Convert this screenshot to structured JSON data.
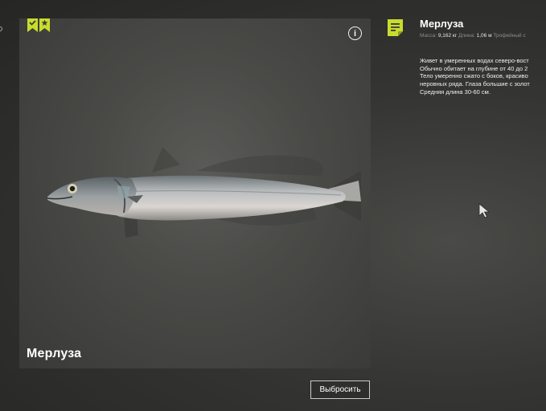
{
  "colors": {
    "accent": "#c8dc2e",
    "text_primary": "#ffffff",
    "text_muted": "#8d8d8a"
  },
  "fish_card": {
    "title": "Мерлуза",
    "bookmark_icons": [
      "bookmark-check-icon",
      "bookmark-star-icon"
    ],
    "info_icon": "i"
  },
  "actions": {
    "discard_label": "Выбросить"
  },
  "details": {
    "title": "Мерлуза",
    "stats": {
      "mass_label": "Масса:",
      "mass_value": "9,162 кг",
      "length_label": "Длина:",
      "length_value": "1,06 м",
      "trophy_label": "Трофейный с"
    },
    "description_lines": [
      "Живет в умеренных водах северо-вост",
      "Обычно обитает на глубине от 40 до 2",
      "Тело умеренно сжато с боков, красиво",
      "неровных ряда. Глаза большие с золот",
      "Средняя длина 30-60 см."
    ]
  }
}
